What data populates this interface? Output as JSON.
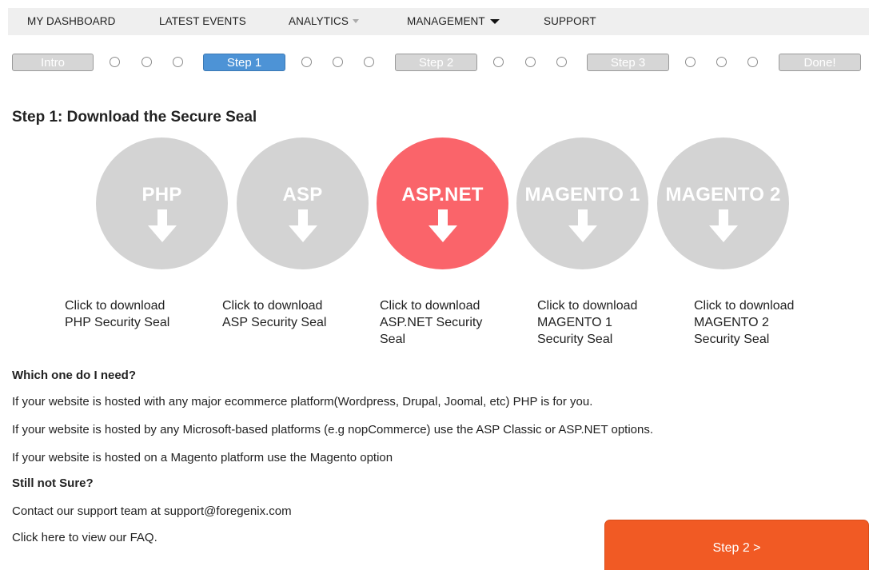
{
  "nav": {
    "items": [
      {
        "label": "MY DASHBOARD"
      },
      {
        "label": "LATEST EVENTS"
      },
      {
        "label": "ANALYTICS"
      },
      {
        "label": "MANAGEMENT"
      },
      {
        "label": "SUPPORT"
      }
    ]
  },
  "progress": {
    "steps": [
      "Intro",
      "Step 1",
      "Step 2",
      "Step 3",
      "Done!"
    ],
    "active": "Step 1"
  },
  "heading": "Step 1: Download the Secure Seal",
  "seals": [
    {
      "label": "PHP",
      "text": "Click to download PHP Security Seal"
    },
    {
      "label": "ASP",
      "text": "Click to download ASP Security Seal"
    },
    {
      "label": "ASP.NET",
      "text": "Click to download ASP.NET Security Seal"
    },
    {
      "label": "MAGENTO 1",
      "text": "Click to download MAGENTO 1 Security Seal"
    },
    {
      "label": "MAGENTO 2",
      "text": "Click to download MAGENTO 2 Security Seal"
    }
  ],
  "selected_seal": "ASP.NET",
  "info": {
    "which_heading": "Which one do I need?",
    "line1": "If your website is hosted with any major ecommerce platform(Wordpress, Drupal, Joomal, etc) PHP is for you.",
    "line2": "If your website is hosted by any Microsoft-based platforms (e.g nopCommerce) use the ASP Classic or ASP.NET options.",
    "line3": "If your website is hosted on a Magento platform use the Magento option",
    "not_sure_heading": "Still not Sure?",
    "contact_prefix": "Contact our support team at ",
    "contact_email": "support@foregenix.com",
    "faq_prefix": "Click ",
    "faq_link": "here",
    "faq_suffix": " to view our FAQ."
  },
  "next_button": "Step 2 >",
  "colors": {
    "active_step": "#4d93d6",
    "selected_seal": "#fa646a",
    "seal": "#d3d3d3",
    "next_button": "#f15a24"
  },
  "icons": {
    "caret_analytics": "caret-down-icon",
    "caret_management": "caret-down-icon",
    "seal_arrow": "arrow-down-icon"
  }
}
